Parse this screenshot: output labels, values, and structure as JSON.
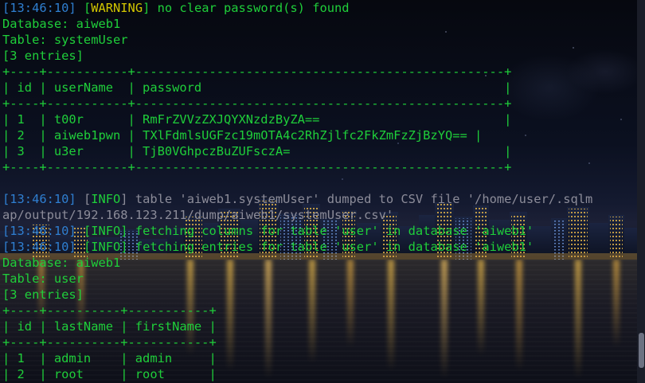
{
  "terminal": {
    "lines": [
      {
        "segments": [
          {
            "text": "[13:46:10] ",
            "color": "blue"
          },
          {
            "text": "[",
            "color": "green"
          },
          {
            "text": "WARNING",
            "color": "yellow"
          },
          {
            "text": "] no clear password(s) found",
            "color": "green"
          }
        ]
      },
      {
        "segments": [
          {
            "text": "Database: aiweb1",
            "color": "green"
          }
        ]
      },
      {
        "segments": [
          {
            "text": "Table: systemUser",
            "color": "green"
          }
        ]
      },
      {
        "segments": [
          {
            "text": "[3 entries]",
            "color": "green"
          }
        ]
      },
      {
        "segments": [
          {
            "text": "+----+-----------+--------------------------------------------------+",
            "color": "green"
          }
        ]
      },
      {
        "segments": [
          {
            "text": "| id | userName  | password                                         |",
            "color": "green"
          }
        ]
      },
      {
        "segments": [
          {
            "text": "+----+-----------+--------------------------------------------------+",
            "color": "green"
          }
        ]
      },
      {
        "segments": [
          {
            "text": "| 1  | t00r      | RmFrZVVzZXJQYXNzdzByZA==                         |",
            "color": "green"
          }
        ]
      },
      {
        "segments": [
          {
            "text": "| 2  | aiweb1pwn | TXlFdmlsUGFzc19mOTA4c2RhZjlfc2FkZmFzZjBzYQ== |",
            "color": "green"
          }
        ]
      },
      {
        "segments": [
          {
            "text": "| 3  | u3er      | TjB0VGhpczBuZUFsczA=                             |",
            "color": "green"
          }
        ]
      },
      {
        "segments": [
          {
            "text": "+----+-----------+--------------------------------------------------+",
            "color": "green"
          }
        ]
      },
      {
        "segments": [
          {
            "text": "",
            "color": "green"
          }
        ]
      },
      {
        "segments": [
          {
            "text": "[13:46:10] ",
            "color": "blue"
          },
          {
            "text": "[",
            "color": "dim"
          },
          {
            "text": "INFO",
            "color": "green"
          },
          {
            "text": "] table 'aiweb1.systemUser' dumped to CSV file '/home/user/.sqlm",
            "color": "dim"
          }
        ]
      },
      {
        "segments": [
          {
            "text": "ap/output/192.168.123.211/dump/aiweb1/systemUser.csv'",
            "color": "dim"
          }
        ]
      },
      {
        "segments": [
          {
            "text": "[13:46:10] ",
            "color": "blue"
          },
          {
            "text": "[",
            "color": "green"
          },
          {
            "text": "INFO",
            "color": "green"
          },
          {
            "text": "] fetching columns for table 'user' in database 'aiweb1'",
            "color": "green"
          }
        ]
      },
      {
        "segments": [
          {
            "text": "[13:46:10] ",
            "color": "blue"
          },
          {
            "text": "[",
            "color": "green"
          },
          {
            "text": "INFO",
            "color": "green"
          },
          {
            "text": "] fetching entries for table 'user' in database 'aiweb1'",
            "color": "green"
          }
        ]
      },
      {
        "segments": [
          {
            "text": "Database: aiweb1",
            "color": "green"
          }
        ]
      },
      {
        "segments": [
          {
            "text": "Table: user",
            "color": "green"
          }
        ]
      },
      {
        "segments": [
          {
            "text": "[3 entries]",
            "color": "green"
          }
        ]
      },
      {
        "segments": [
          {
            "text": "+----+----------+-----------+",
            "color": "green"
          }
        ]
      },
      {
        "segments": [
          {
            "text": "| id | lastName | firstName |",
            "color": "green"
          }
        ]
      },
      {
        "segments": [
          {
            "text": "+----+----------+-----------+",
            "color": "green"
          }
        ]
      },
      {
        "segments": [
          {
            "text": "| 1  | admin    | admin     |",
            "color": "green"
          }
        ]
      },
      {
        "segments": [
          {
            "text": "| 2  | root     | root      |",
            "color": "green"
          }
        ]
      }
    ]
  },
  "colors": {
    "green": "#1fcf3a",
    "blue": "#2f7fd1",
    "yellow": "#d2c600",
    "dim": "#8c8c99"
  }
}
